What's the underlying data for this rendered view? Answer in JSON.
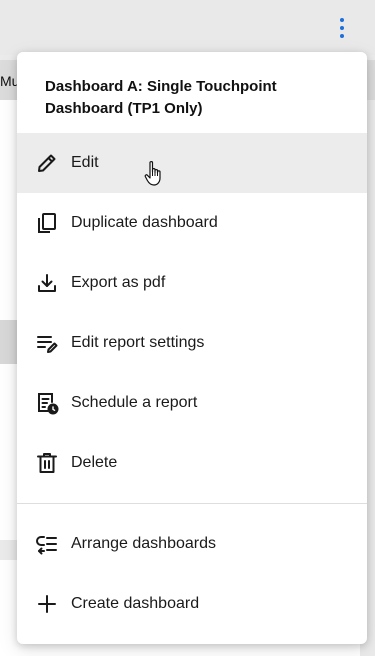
{
  "background": {
    "partial_text": "Mu",
    "kebab_icon": "more-vertical-icon",
    "accent_color": "#1e6fd9"
  },
  "menu": {
    "title": "Dashboard A: Single Touchpoint Dashboard (TP1 Only)",
    "items": [
      {
        "label": "Edit",
        "icon": "pencil-icon",
        "hovered": true
      },
      {
        "label": "Duplicate dashboard",
        "icon": "copy-icon"
      },
      {
        "label": "Export as pdf",
        "icon": "download-icon"
      },
      {
        "label": "Edit report settings",
        "icon": "edit-list-icon"
      },
      {
        "label": "Schedule a report",
        "icon": "schedule-report-icon"
      },
      {
        "label": "Delete",
        "icon": "trash-icon"
      }
    ],
    "secondary_items": [
      {
        "label": "Arrange dashboards",
        "icon": "arrange-icon"
      },
      {
        "label": "Create dashboard",
        "icon": "plus-icon"
      }
    ]
  },
  "cursor_icon": "hand-pointer-icon"
}
